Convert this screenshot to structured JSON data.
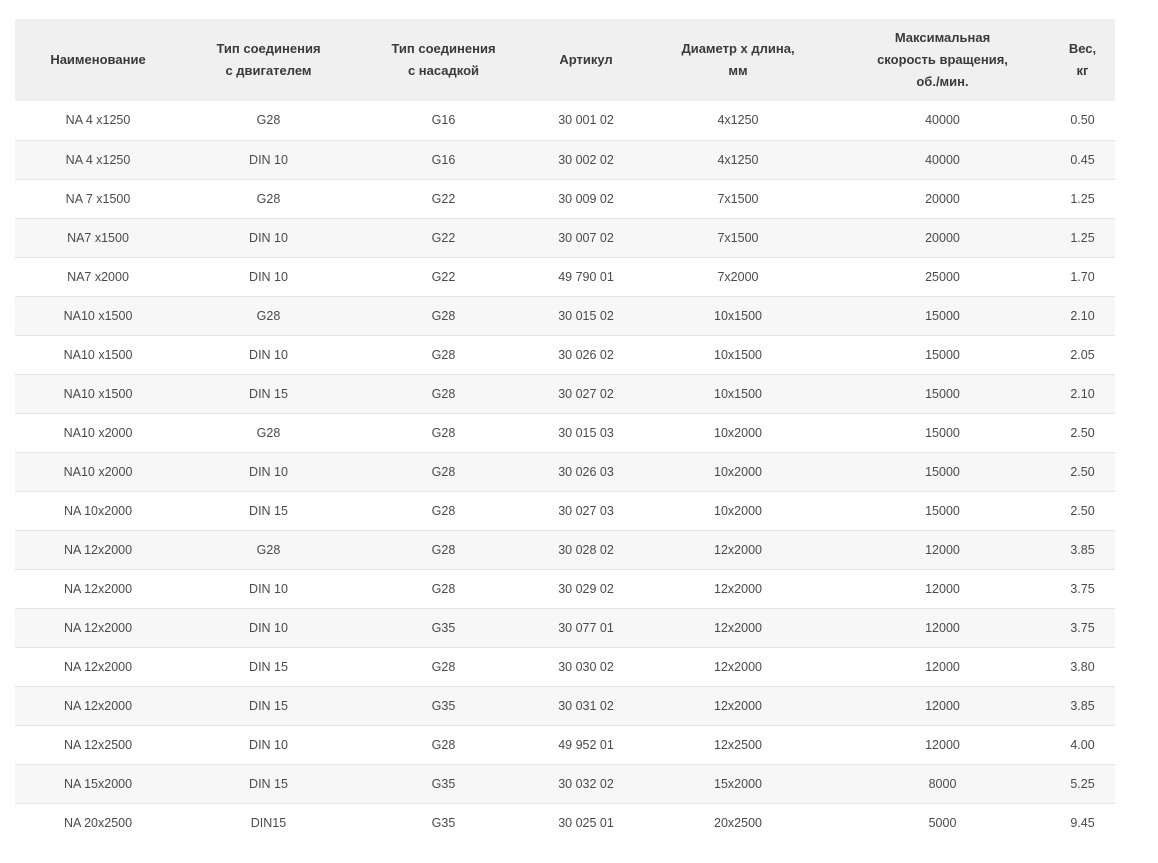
{
  "table": {
    "headers": [
      "Наименование",
      "Тип соединения\nс двигателем",
      "Тип соединения\nс насадкой",
      "Артикул",
      "Диаметр х длина,\nмм",
      "Максимальная\nскорость вращения,\nоб./мин.",
      "Вес,\nкг"
    ],
    "rows": [
      [
        "NA 4 x1250",
        "G28",
        "G16",
        "30 001 02",
        "4x1250",
        "40000",
        "0.50"
      ],
      [
        "NA 4 x1250",
        "DIN 10",
        "G16",
        "30 002 02",
        "4x1250",
        "40000",
        "0.45"
      ],
      [
        "NA 7 x1500",
        "G28",
        "G22",
        "30 009 02",
        "7x1500",
        "20000",
        "1.25"
      ],
      [
        "NA7 x1500",
        "DIN 10",
        "G22",
        "30 007 02",
        "7x1500",
        "20000",
        "1.25"
      ],
      [
        "NA7 x2000",
        "DIN 10",
        "G22",
        "49 790 01",
        "7x2000",
        "25000",
        "1.70"
      ],
      [
        "NA10 x1500",
        "G28",
        "G28",
        "30 015 02",
        "10x1500",
        "15000",
        "2.10"
      ],
      [
        "NA10 x1500",
        "DIN 10",
        "G28",
        "30 026 02",
        "10x1500",
        "15000",
        "2.05"
      ],
      [
        "NA10 x1500",
        "DIN 15",
        "G28",
        "30 027 02",
        "10x1500",
        "15000",
        "2.10"
      ],
      [
        "NA10 x2000",
        "G28",
        "G28",
        "30 015 03",
        "10x2000",
        "15000",
        "2.50"
      ],
      [
        "NA10 x2000",
        "DIN 10",
        "G28",
        "30 026 03",
        "10x2000",
        "15000",
        "2.50"
      ],
      [
        "NA 10x2000",
        "DIN 15",
        "G28",
        "30 027 03",
        "10x2000",
        "15000",
        "2.50"
      ],
      [
        "NA 12x2000",
        "G28",
        "G28",
        "30 028 02",
        "12x2000",
        "12000",
        "3.85"
      ],
      [
        "NA 12x2000",
        "DIN 10",
        "G28",
        "30 029 02",
        "12x2000",
        "12000",
        "3.75"
      ],
      [
        "NA 12x2000",
        "DIN 10",
        "G35",
        "30 077 01",
        "12x2000",
        "12000",
        "3.75"
      ],
      [
        "NA 12x2000",
        "DIN 15",
        "G28",
        "30 030 02",
        "12x2000",
        "12000",
        "3.80"
      ],
      [
        "NA 12x2000",
        "DIN 15",
        "G35",
        "30 031 02",
        "12x2000",
        "12000",
        "3.85"
      ],
      [
        "NA 12x2500",
        "DIN 10",
        "G28",
        "49 952 01",
        "12x2500",
        "12000",
        "4.00"
      ],
      [
        "NA 15x2000",
        "DIN 15",
        "G35",
        "30 032 02",
        "15x2000",
        "8000",
        "5.25"
      ],
      [
        "NA 20x2500",
        "DIN15",
        "G35",
        "30 025 01",
        "20x2500",
        "5000",
        "9.45"
      ]
    ]
  }
}
